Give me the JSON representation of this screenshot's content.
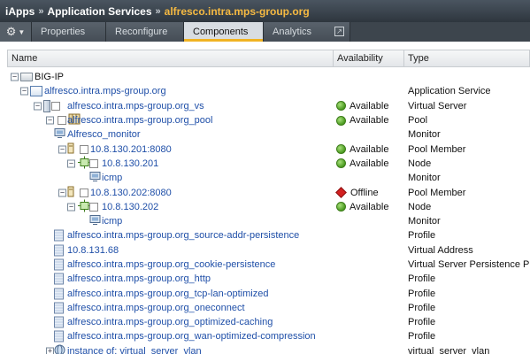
{
  "breadcrumb": {
    "items": [
      "iApps",
      "Application Services"
    ],
    "current": "alfresco.intra.mps-group.org",
    "separator": "»"
  },
  "tabs": [
    {
      "label": "Properties",
      "active": false
    },
    {
      "label": "Reconfigure",
      "active": false
    },
    {
      "label": "Components",
      "active": true
    },
    {
      "label": "Analytics",
      "active": false
    }
  ],
  "columns": {
    "name": "Name",
    "availability": "Availability",
    "type": "Type"
  },
  "tree": [
    {
      "label": "BIG-IP",
      "icon": "server-icon",
      "toggle": "−",
      "checkbox": false,
      "availability": "",
      "status": "",
      "type": ""
    },
    {
      "label": "alfresco.intra.mps-group.org",
      "icon": "application-service-icon",
      "toggle": "−",
      "checkbox": false,
      "availability": "",
      "status": "",
      "type": "Application Service"
    },
    {
      "label": "alfresco.intra.mps-group.org_vs",
      "icon": "virtual-server-icon",
      "toggle": "−",
      "checkbox": true,
      "availability": "Available",
      "status": "green",
      "type": "Virtual Server"
    },
    {
      "label": "alfresco.intra.mps-group.org_pool",
      "icon": "pool-icon",
      "toggle": "−",
      "checkbox": true,
      "availability": "Available",
      "status": "green",
      "type": "Pool"
    },
    {
      "label": "Alfresco_monitor",
      "icon": "monitor-icon",
      "toggle": "",
      "checkbox": false,
      "availability": "",
      "status": "",
      "type": "Monitor"
    },
    {
      "label": "10.8.130.201:8080",
      "icon": "pool-member-icon",
      "toggle": "−",
      "checkbox": true,
      "availability": "Available",
      "status": "green",
      "type": "Pool Member"
    },
    {
      "label": "10.8.130.201",
      "icon": "node-icon",
      "toggle": "−",
      "checkbox": true,
      "availability": "Available",
      "status": "green",
      "type": "Node"
    },
    {
      "label": "icmp",
      "icon": "monitor-icon",
      "toggle": "",
      "checkbox": false,
      "availability": "",
      "status": "",
      "type": "Monitor"
    },
    {
      "label": "10.8.130.202:8080",
      "icon": "pool-member-icon",
      "toggle": "−",
      "checkbox": true,
      "availability": "Offline",
      "status": "red",
      "type": "Pool Member"
    },
    {
      "label": "10.8.130.202",
      "icon": "node-icon",
      "toggle": "−",
      "checkbox": true,
      "availability": "Available",
      "status": "green",
      "type": "Node"
    },
    {
      "label": "icmp",
      "icon": "monitor-icon",
      "toggle": "",
      "checkbox": false,
      "availability": "",
      "status": "",
      "type": "Monitor"
    },
    {
      "label": "alfresco.intra.mps-group.org_source-addr-persistence",
      "icon": "profile-icon",
      "toggle": "",
      "checkbox": false,
      "availability": "",
      "status": "",
      "type": "Profile"
    },
    {
      "label": "10.8.131.68",
      "icon": "profile-icon",
      "toggle": "",
      "checkbox": false,
      "availability": "",
      "status": "",
      "type": "Virtual Address"
    },
    {
      "label": "alfresco.intra.mps-group.org_cookie-persistence",
      "icon": "profile-icon",
      "toggle": "",
      "checkbox": false,
      "availability": "",
      "status": "",
      "type": "Virtual Server Persistence Profile"
    },
    {
      "label": "alfresco.intra.mps-group.org_http",
      "icon": "profile-icon",
      "toggle": "",
      "checkbox": false,
      "availability": "",
      "status": "",
      "type": "Profile"
    },
    {
      "label": "alfresco.intra.mps-group.org_tcp-lan-optimized",
      "icon": "profile-icon",
      "toggle": "",
      "checkbox": false,
      "availability": "",
      "status": "",
      "type": "Profile"
    },
    {
      "label": "alfresco.intra.mps-group.org_oneconnect",
      "icon": "profile-icon",
      "toggle": "",
      "checkbox": false,
      "availability": "",
      "status": "",
      "type": "Profile"
    },
    {
      "label": "alfresco.intra.mps-group.org_optimized-caching",
      "icon": "profile-icon",
      "toggle": "",
      "checkbox": false,
      "availability": "",
      "status": "",
      "type": "Profile"
    },
    {
      "label": "alfresco.intra.mps-group.org_wan-optimized-compression",
      "icon": "profile-icon",
      "toggle": "",
      "checkbox": false,
      "availability": "",
      "status": "",
      "type": "Profile"
    },
    {
      "label": "instance of: virtual_server_vlan",
      "icon": "vlan-icon",
      "toggle": "+",
      "checkbox": false,
      "availability": "",
      "status": "",
      "type": "virtual_server_vlan"
    }
  ]
}
